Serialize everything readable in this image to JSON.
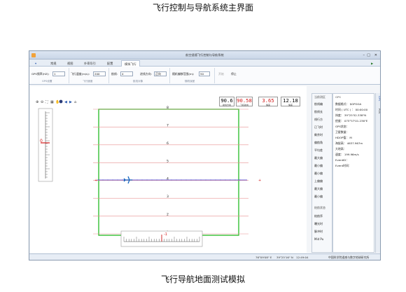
{
  "page": {
    "caption_top": "飞行控制与导航系统主界面",
    "caption_bottom": "飞行导航地面测试模拟"
  },
  "window": {
    "title": "航空遥感飞行控制与导航系统",
    "tabs": [
      {
        "label": "常规",
        "active": false
      },
      {
        "label": "视图",
        "active": false
      },
      {
        "label": "外寄导引",
        "active": false
      },
      {
        "label": "配置",
        "active": false
      },
      {
        "label": "模拟飞行",
        "active": true
      }
    ]
  },
  "ribbon": {
    "gps_freq_label": "GPS频率(HZ):",
    "gps_freq_value": "1",
    "speed_label": "飞行速度(m/s):",
    "speed_value": "200",
    "route_label": "航线:",
    "route_value": "4",
    "direction_label": "进线方向:",
    "direction_value": "正向",
    "random_label": "随机偏移范围(m):",
    "random_value": "50",
    "start_label": "开始",
    "stop_label": "停止",
    "groups": [
      "GPS设置",
      "飞行速度",
      "航线对象",
      "随机误差"
    ]
  },
  "readouts": [
    {
      "value": "90.6",
      "label": "航线方向",
      "color": "#111111"
    },
    {
      "value": "90.58",
      "label": "飞机航向",
      "color": "#d11a1a"
    },
    {
      "value": "3.65",
      "label": "偏差",
      "color": "#d11a1a"
    },
    {
      "value": "12.18",
      "label": "偏差",
      "color": "#111111"
    }
  ],
  "plot": {
    "altitude_marker": "0",
    "line_labels": [
      "8",
      "7",
      "6",
      "5",
      "4",
      "3",
      "2",
      "1"
    ],
    "bottom_scale_marker": "-1"
  },
  "side_panel": {
    "header": "当前测区",
    "items": [
      "航线编",
      "航线长",
      "线行方",
      "已飞时",
      "剩余时",
      "偏航角",
      "平均差",
      "最大偏",
      "最小偏",
      "最小偏",
      "上偏偏",
      "最大偏",
      "最小偏"
    ],
    "footer_header": "结航状态",
    "footer_items": [
      "结航序",
      "曝光时",
      "脉冲时",
      "Mid Pu"
    ]
  },
  "gps_panel": {
    "title": "GPS",
    "lines": [
      "数据格式：  $GPGGA",
      "时间 ( UTC ) ：  00:00:00",
      "纬度：  39°25'52.338\"N",
      "经度：  075°57'01.236\"E",
      "GPS状态：",
      "卫星数量：",
      "HDOP值：  M",
      "海拔高：  4637.967m",
      "大地高：",
      "速度：  199.96m/s",
      "EventID：",
      "Event时间："
    ]
  },
  "vtabs": [
    "GPS",
    "POS"
  ],
  "status": {
    "lon": "76°09'08\" E",
    "lat": "39°25'16\" N",
    "time": "12:49:04",
    "org": "中国科学院遥感与数字地球研究所"
  }
}
